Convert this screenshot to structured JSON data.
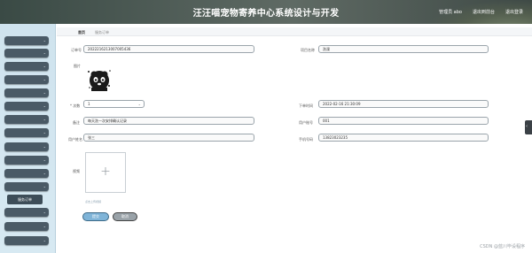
{
  "header": {
    "title": "汪汪喵宠物寄养中心系统设计与开发",
    "user_label": "管理员 abo",
    "back_label": "退出到前台",
    "logout_label": "退出登录"
  },
  "sidebar": {
    "menu_items": [
      "",
      "",
      "",
      "",
      "",
      "",
      "",
      "",
      "",
      "",
      "",
      "",
      ""
    ],
    "active_sub": "服务订单"
  },
  "breadcrumb": {
    "home": "首页",
    "current": "服务订单"
  },
  "form": {
    "order_no_label": "订单号",
    "order_no_value": "2022216213007005436",
    "service_name_label": "项目名称",
    "service_name_value": "洗澡",
    "image_label": "图片",
    "count_label": "* 次数",
    "count_value": "1",
    "order_time_label": "下单时间",
    "order_time_value": "2022-02-16 21:30:09",
    "remark_label": "备注",
    "remark_value": "每天洗一次安排确认记录",
    "user_account_label": "用户账号",
    "user_account_value": "001",
    "user_name_label": "用户姓名",
    "user_name_value": "张三",
    "phone_label": "手机号码",
    "phone_value": "13823023235",
    "video_label": "视频",
    "upload_note": "点击上传视频",
    "submit_label": "提交",
    "cancel_label": "取消"
  },
  "watermark": "CSDN @蓝川毕设程序"
}
